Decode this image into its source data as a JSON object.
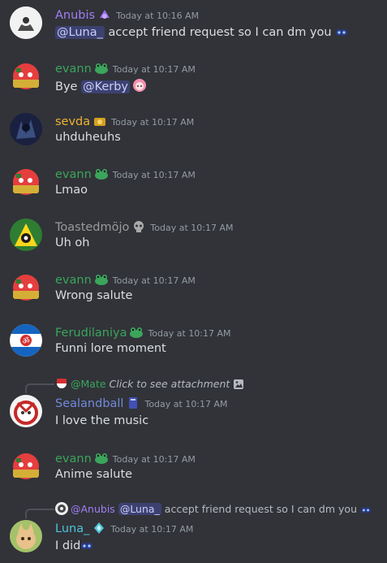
{
  "messages": [
    {
      "author": "Anubis",
      "color": "#a27df5",
      "time": "Today at 10:16 AM",
      "mention": "@Luna_",
      "text": " accept friend request so I can dm you ",
      "emoji": "pleading-eyes-emoji"
    },
    {
      "author": "evann",
      "color": "#3ba55c",
      "time": "Today at 10:17 AM",
      "prefix": "Bye ",
      "mention": "@Kerby",
      "emoji": "anime-girl-emoji"
    },
    {
      "author": "sevda",
      "color": "#f0b232",
      "time": "Today at 10:17 AM",
      "text": "uhduheuhs"
    },
    {
      "author": "evann",
      "color": "#3ba55c",
      "time": "Today at 10:17 AM",
      "text": "Lmao"
    },
    {
      "author": "Toastedmöjo",
      "color": "#9a9a9a",
      "time": "Today at 10:17 AM",
      "text": "Uh oh"
    },
    {
      "author": "evann",
      "color": "#3ba55c",
      "time": "Today at 10:17 AM",
      "text": "Wrong salute"
    },
    {
      "author": "Ferudilaniya",
      "color": "#3ba55c",
      "time": "Today at 10:17 AM",
      "text": "Funni lore moment"
    },
    {
      "author": "Sealandball",
      "color": "#7289da",
      "time": "Today at 10:17 AM",
      "text": "I love the music",
      "reply": {
        "author": "@Mate",
        "text": "Click to see attachment"
      }
    },
    {
      "author": "evann",
      "color": "#3ba55c",
      "time": "Today at 10:17 AM",
      "text": "Anime salute"
    },
    {
      "author": "Luna_",
      "color": "#4fc3d9",
      "time": "Today at 10:17 AM",
      "text": "I did",
      "emoji": "salute-emoji",
      "reply": {
        "author": "@Anubis",
        "mention": "@Luna_",
        "text": " accept friend request so I can dm you "
      }
    }
  ]
}
